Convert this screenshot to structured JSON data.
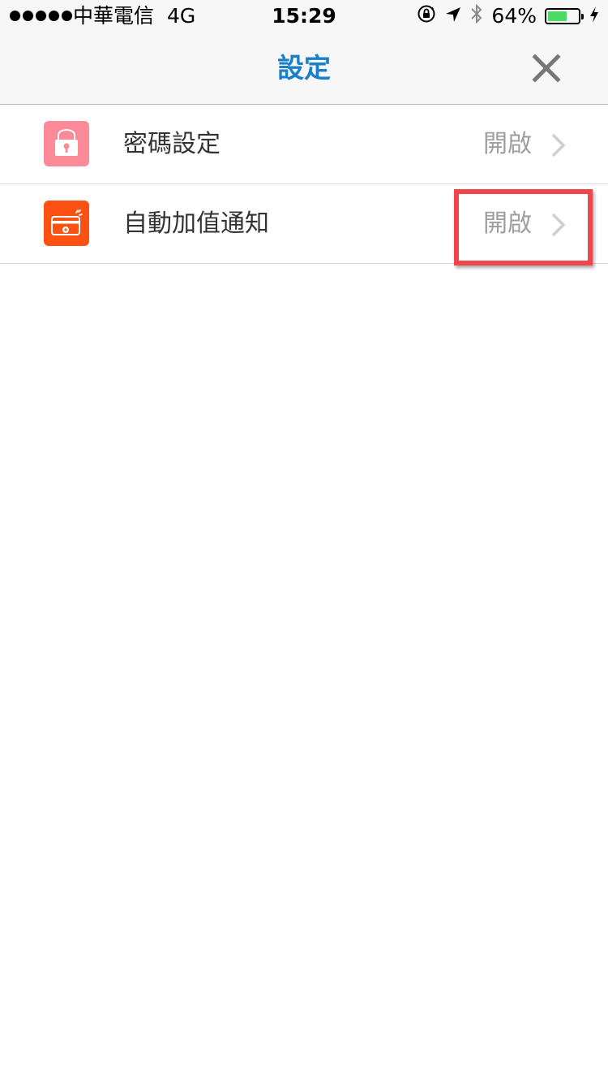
{
  "status_bar": {
    "carrier": "中華電信",
    "network": "4G",
    "time": "15:29",
    "battery_percent": "64%",
    "battery_level": 0.64,
    "battery_color": "#4cd964",
    "icons": [
      "signal-dots-icon",
      "orientation-lock-icon",
      "location-arrow-icon",
      "bluetooth-icon",
      "battery-icon",
      "charging-bolt-icon"
    ]
  },
  "nav": {
    "title": "設定",
    "title_color": "#1a7fc9",
    "close_icon": "close-icon"
  },
  "settings": {
    "items": [
      {
        "label": "密碼設定",
        "value": "開啟",
        "icon": "lock-icon",
        "icon_color": "#fd8a98"
      },
      {
        "label": "自動加值通知",
        "value": "開啟",
        "icon": "card-icon",
        "icon_color": "#fc5113"
      }
    ]
  },
  "highlight_color": "#f0454c"
}
